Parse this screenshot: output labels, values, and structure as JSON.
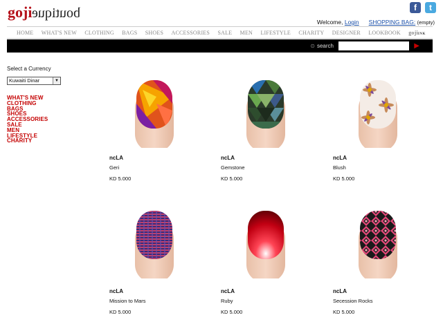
{
  "header": {
    "logo_goji": "goji",
    "logo_boutique": "boutique",
    "facebook_glyph": "f",
    "twitter_glyph": "t",
    "welcome": "Welcome,",
    "login": "Login",
    "bag_label": "SHOPPING BAG:",
    "bag_status": "(empty)"
  },
  "nav": {
    "items": [
      "HOME",
      "WHAT'S NEW",
      "CLOTHING",
      "BAGS",
      "SHOES",
      "ACCESSORIES",
      "SALE",
      "MEN",
      "LIFESTYLE",
      "CHARITY",
      "DESIGNER",
      "LOOKBOOK"
    ],
    "gojiink_a": "goji",
    "gojiink_b": "INK"
  },
  "search": {
    "label": "search",
    "go_glyph": "▶"
  },
  "sidebar": {
    "currency_label": "Select a Currency",
    "currency_value": "Kuwaiti Dinar",
    "categories": [
      "WHAT'S NEW",
      "CLOTHING",
      "BAGS",
      "SHOES",
      "ACCESSORIES",
      "SALE",
      "MEN",
      "LIFESTYLE",
      "CHARITY"
    ]
  },
  "products": [
    {
      "brand": "ncLA",
      "name": "Geri",
      "price": "KD 5.000",
      "icon": "nail-orange-geometric"
    },
    {
      "brand": "ncLA",
      "name": "Gemstone",
      "price": "KD 5.000",
      "icon": "nail-teal-gemstone"
    },
    {
      "brand": "ncLA",
      "name": "Blush",
      "price": "KD 5.000",
      "icon": "nail-floral"
    },
    {
      "brand": "ncLA",
      "name": "Mission to Mars",
      "price": "KD 5.000",
      "icon": "nail-purple-stripes"
    },
    {
      "brand": "ncLA",
      "name": "Ruby",
      "price": "KD 5.000",
      "icon": "nail-red-burst"
    },
    {
      "brand": "ncLA",
      "name": "Secession Rocks",
      "price": "KD 5.000",
      "icon": "nail-pink-aztec"
    }
  ]
}
